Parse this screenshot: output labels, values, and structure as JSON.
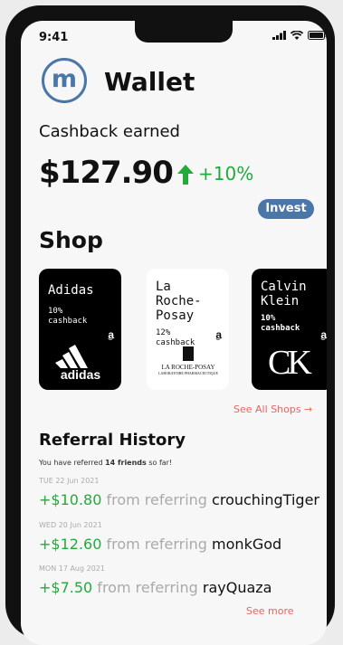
{
  "status": {
    "time": "9:41"
  },
  "header": {
    "logo_letter": "m",
    "title": "Wallet"
  },
  "cashback": {
    "label": "Cashback earned",
    "amount": "$127.90",
    "change": "+10%"
  },
  "invest_label": "Invest",
  "shop": {
    "heading": "Shop",
    "cards": [
      {
        "brand": "Adidas",
        "percent": "10%",
        "cashback": "cashback",
        "logo_text": "adidas",
        "theme": "dark"
      },
      {
        "brand": "La Roche-Posay",
        "percent": "12%",
        "cashback": "cashback",
        "logo_text": "LA ROCHE-POSAY",
        "logo_sub": "LABORATOIRE PHARMACEUTIQUE",
        "theme": "light"
      },
      {
        "brand": "Calvin Klein",
        "percent": "10%",
        "cashback": "cashback",
        "logo_text": "CK",
        "theme": "dark"
      }
    ],
    "see_all": "See All Shops →"
  },
  "referral": {
    "heading": "Referral History",
    "summary_prefix": "You have referred ",
    "summary_count": "14 friends",
    "summary_suffix": " so far!",
    "connector": " from referring ",
    "items": [
      {
        "date": "TUE 22 Jun 2021",
        "amount": "+$10.80",
        "user": "crouchingTiger"
      },
      {
        "date": "WED 20 Jun 2021",
        "amount": "+$12.60",
        "user": "monkGod"
      },
      {
        "date": "MON 17 Aug 2021",
        "amount": "+$7.50",
        "user": "rayQuaza"
      }
    ],
    "see_more": "See more"
  },
  "colors": {
    "accent": "#4a76a8",
    "positive": "#22aa3b",
    "link": "#f06060"
  }
}
